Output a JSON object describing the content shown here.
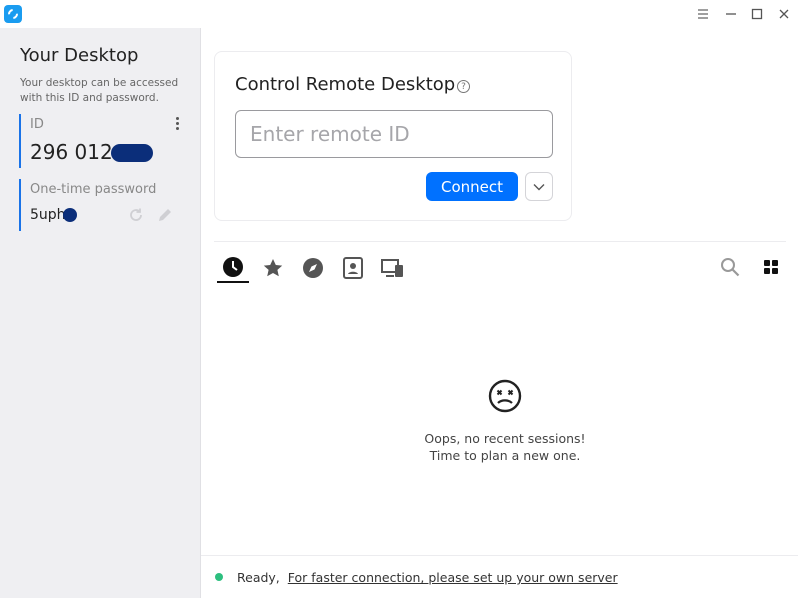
{
  "window": {
    "minimize": "–",
    "maximize": "☐",
    "close": "✕"
  },
  "sidebar": {
    "title": "Your Desktop",
    "description": "Your desktop can be accessed with this ID and password.",
    "id_label": "ID",
    "id_value": "296 012",
    "password_label": "One-time password",
    "password_value": "5uph"
  },
  "connect_card": {
    "title": "Control Remote Desktop",
    "input_placeholder": "Enter remote ID",
    "input_value": "",
    "connect_label": "Connect"
  },
  "tabs": [
    {
      "icon": "clock-icon",
      "name": "recent-sessions",
      "active": true
    },
    {
      "icon": "star-icon",
      "name": "favorites",
      "active": false
    },
    {
      "icon": "compass-icon",
      "name": "discovered",
      "active": false
    },
    {
      "icon": "address-book-icon",
      "name": "address-book",
      "active": false
    },
    {
      "icon": "devices-icon",
      "name": "devices",
      "active": false
    }
  ],
  "empty_state": {
    "line1": "Oops, no recent sessions!",
    "line2": "Time to plan a new one."
  },
  "status": {
    "state": "Ready,",
    "link": "For faster connection, please set up your own server",
    "dot_color": "#2dbf7f"
  },
  "colors": {
    "accent": "#0071ff",
    "brand": "#1a9cf0"
  }
}
